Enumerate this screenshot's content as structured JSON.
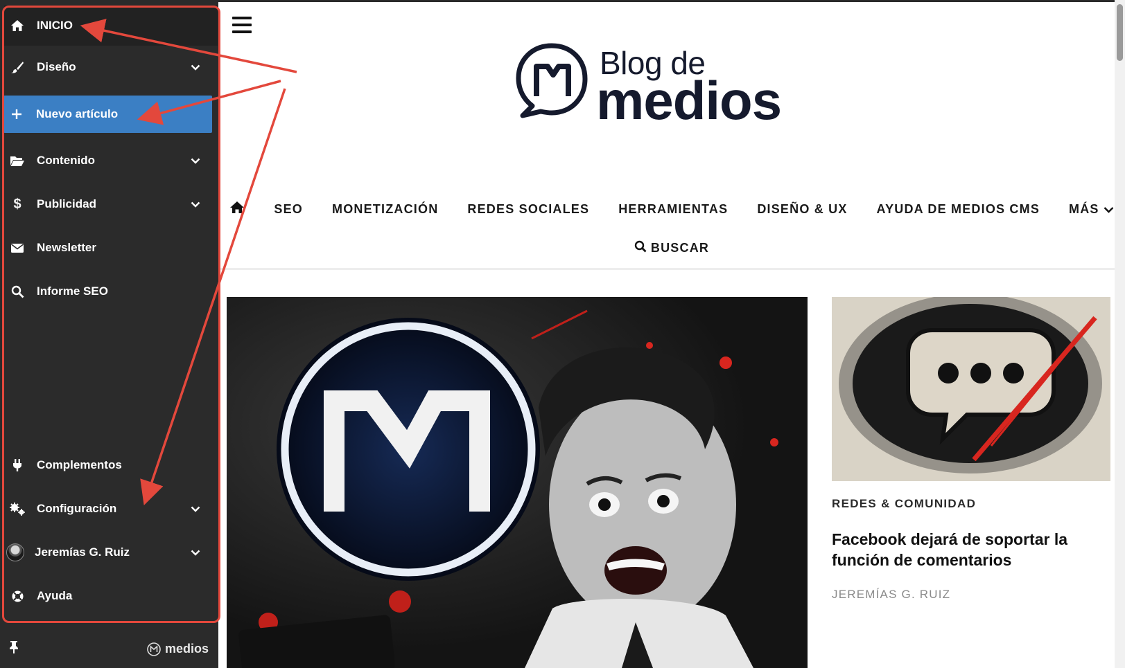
{
  "sidebar": {
    "items": [
      {
        "label": "INICIO",
        "icon": "home-icon"
      },
      {
        "label": "Diseño",
        "icon": "brush-icon"
      },
      {
        "label": "Nuevo artículo",
        "icon": "plus-icon"
      },
      {
        "label": "Contenido",
        "icon": "folder-icon"
      },
      {
        "label": "Publicidad",
        "icon": "dollar-icon"
      },
      {
        "label": "Newsletter",
        "icon": "envelope-icon"
      },
      {
        "label": "Informe SEO",
        "icon": "search-icon"
      },
      {
        "label": "Complementos",
        "icon": "plug-icon"
      },
      {
        "label": "Configuración",
        "icon": "gears-icon"
      },
      {
        "label": "Jeremías G. Ruiz",
        "icon": "avatar"
      },
      {
        "label": "Ayuda",
        "icon": "lifebuoy-icon"
      }
    ],
    "footer": {
      "brand": "medios"
    }
  },
  "header": {
    "logo_small": "Blog de",
    "logo_big": "medios"
  },
  "nav": {
    "items": [
      "SEO",
      "MONETIZACIÓN",
      "REDES SOCIALES",
      "HERRAMIENTAS",
      "DISEÑO & UX",
      "AYUDA DE MEDIOS CMS",
      "MÁS"
    ],
    "search": "BUSCAR"
  },
  "card": {
    "category": "REDES & COMUNIDAD",
    "title": "Facebook dejará de soportar la función de comentarios",
    "author": "JEREMÍAS G. RUIZ"
  },
  "colors": {
    "sidebar_bg": "#2b2b2b",
    "active_item": "#3b7fc4",
    "annotation": "#e3483c",
    "logo_text": "#151a2d"
  }
}
